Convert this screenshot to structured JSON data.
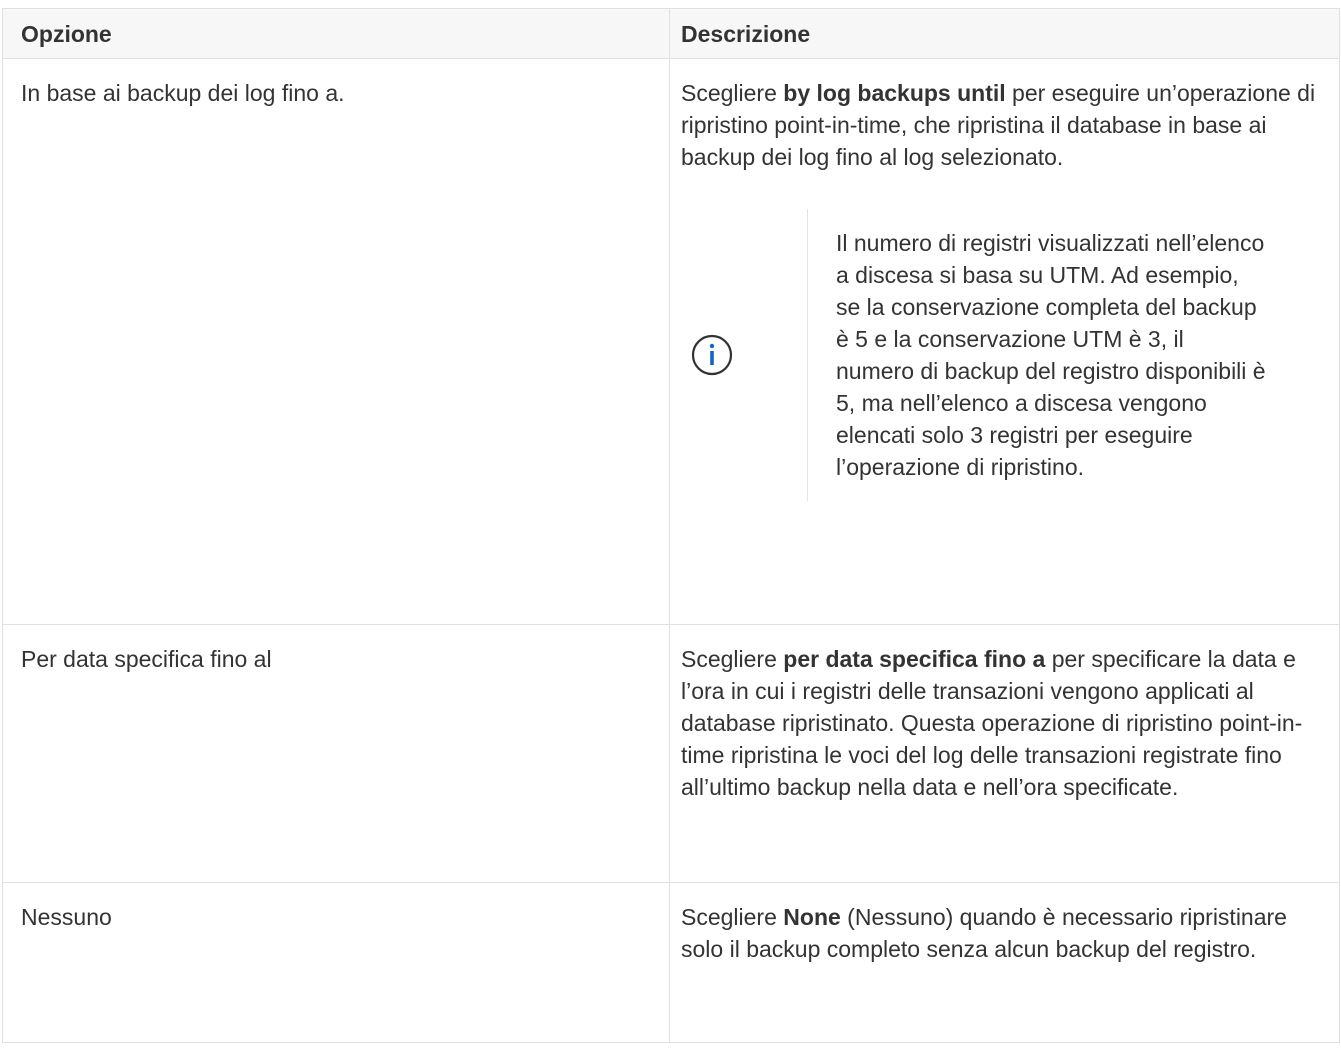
{
  "table": {
    "headers": {
      "option": "Opzione",
      "description": "Descrizione"
    },
    "rows": [
      {
        "option": "In base ai backup dei log fino a.",
        "desc_before": "Scegliere ",
        "desc_bold": "by log backups until",
        "desc_after": " per eseguire un’operazione di ripristino point-in-time, che ripristina il database in base ai backup dei log fino al log selezionato.",
        "note": {
          "icon": "info-icon",
          "text": "Il numero di registri visualizzati nell’elenco a discesa si basa su UTM. Ad esempio, se la conservazione completa del backup è 5 e la conservazione UTM è 3, il numero di backup del registro disponibili è 5, ma nell’elenco a discesa vengono elencati solo 3 registri per eseguire l’operazione di ripristino."
        }
      },
      {
        "option": "Per data specifica fino al",
        "desc_before": "Scegliere ",
        "desc_bold": "per data specifica fino a",
        "desc_after": " per specificare la data e l’ora in cui i registri delle transazioni vengono applicati al database ripristinato. Questa operazione di ripristino point-in-time ripristina le voci del log delle transazioni registrate fino all’ultimo backup nella data e nell’ora specificate."
      },
      {
        "option": "Nessuno",
        "desc_before": "Scegliere ",
        "desc_bold": "None",
        "desc_after": " (Nessuno) quando è necessario ripristinare solo il backup completo senza alcun backup del registro."
      }
    ]
  },
  "colors": {
    "text": "#333333",
    "header_bg": "#f7f7f7",
    "border": "#e0e0e0",
    "info_icon": "#1565c0"
  }
}
